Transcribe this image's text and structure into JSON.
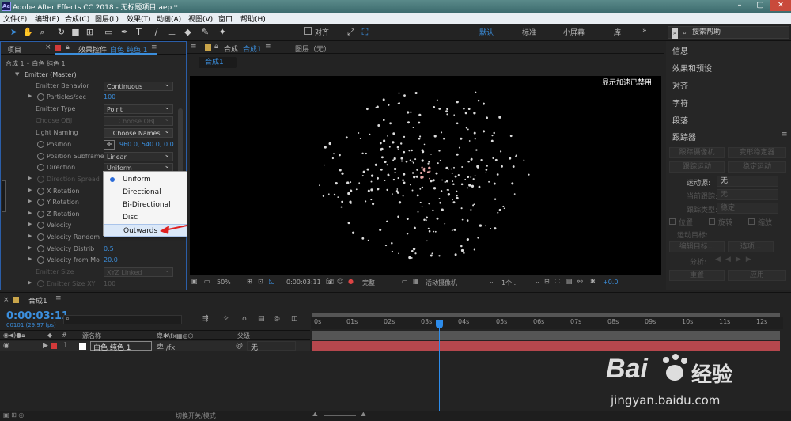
{
  "titlebar": {
    "app_icon": "Ae",
    "title": "Adobe After Effects CC 2018 - 无标题项目.aep *"
  },
  "menu": [
    "文件(F)",
    "编辑(E)",
    "合成(C)",
    "图层(L)",
    "效果(T)",
    "动画(A)",
    "视图(V)",
    "窗口",
    "帮助(H)"
  ],
  "toolbar": {
    "snap_label": "对齐",
    "workspaces": [
      "默认",
      "标准",
      "小屏幕",
      "库"
    ],
    "active_workspace": "默认",
    "search_placeholder": "搜索帮助"
  },
  "left_panel": {
    "tab_project": "项目",
    "tab_effects": "效果控件",
    "tab_effects_layer": "白色 纯色 1",
    "breadcrumb": "合成 1 • 白色 纯色 1",
    "rows": [
      {
        "label": "Emitter (Master)"
      },
      {
        "label": "Emitter Behavior",
        "value": "Continuous"
      },
      {
        "label": "Particles/sec",
        "value": "100"
      },
      {
        "label": "Emitter Type",
        "value": "Point"
      },
      {
        "label": "Choose OBJ",
        "value": "Choose OBJ..."
      },
      {
        "label": "Light Naming",
        "value": "Choose Names..."
      },
      {
        "label": "Position",
        "value": "960.0, 540.0, 0.0"
      },
      {
        "label": "Position Subframe",
        "value": "Linear"
      },
      {
        "label": "Direction",
        "value": "Uniform"
      },
      {
        "label": "Direction Spread"
      },
      {
        "label": "X Rotation"
      },
      {
        "label": "Y Rotation"
      },
      {
        "label": "Z Rotation"
      },
      {
        "label": "Velocity"
      },
      {
        "label": "Velocity Random"
      },
      {
        "label": "Velocity Distrib",
        "value": "0.5"
      },
      {
        "label": "Velocity from Mo",
        "value": "20.0"
      },
      {
        "label": "Emitter Size",
        "value": "XYZ Linked"
      },
      {
        "label": "Emitter Size XY",
        "value": "100"
      }
    ],
    "popup_options": [
      "Uniform",
      "Directional",
      "Bi-Directional",
      "Disc",
      "Outwards"
    ],
    "popup_selected": "Uniform",
    "popup_highlighted": "Outwards"
  },
  "comp_panel": {
    "tab_label": "合成",
    "comp_name": "合成1",
    "layer_tab": "图层（无）",
    "sub_tab": "合成1",
    "gpu_notice": "显示加速已禁用",
    "zoom": "50%",
    "timecode": "0:00:03:11",
    "resolution": "完整",
    "camera": "活动摄像机",
    "views": "1个...",
    "exposure": "+0.0"
  },
  "right_panel": {
    "items": [
      "信息",
      "效果和预设",
      "对齐",
      "字符",
      "段落"
    ],
    "tracker_title": "跟踪器",
    "buttons": [
      "跟踪摄像机",
      "变形稳定器",
      "跟踪运动",
      "稳定运动"
    ],
    "motion_source_label": "运动源:",
    "motion_source_value": "无",
    "current_track_label": "当前跟踪:",
    "current_track_value": "无",
    "track_type_label": "跟踪类型:",
    "track_type_value": "稳定",
    "checks": [
      "位置",
      "旋转",
      "缩放"
    ],
    "motion_target": "运动目标:",
    "edit_target": "编辑目标...",
    "options": "选项...",
    "analyze": "分析:",
    "reset": "重置",
    "apply": "应用"
  },
  "timeline": {
    "tab_label": "合成1",
    "timecode": "0:00:03:11",
    "frame_info": "00101 (29.97 fps)",
    "col_source": "源名称",
    "col_parent": "父级",
    "layer_index": "1",
    "layer_name": "白色 纯色 1",
    "parent_value": "无",
    "ticks": [
      "0s",
      "01s",
      "02s",
      "03s",
      "04s",
      "05s",
      "06s",
      "07s",
      "08s",
      "09s",
      "10s",
      "11s",
      "12s"
    ],
    "colors": {
      "layer_bar": "#b5474d",
      "playhead": "#2d8ceb"
    }
  },
  "status": {
    "toggle_label": "切换开关/模式"
  },
  "watermark": {
    "brand": "Bai",
    "brand_suffix": "经验",
    "url": "jingyan.baidu.com"
  }
}
